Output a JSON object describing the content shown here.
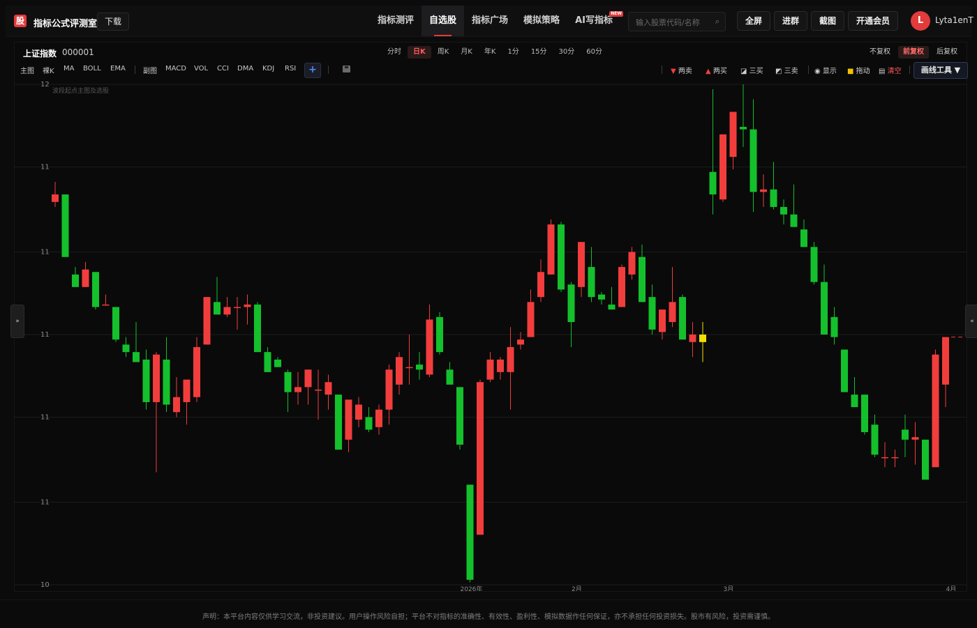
{
  "header": {
    "logo_char": "股",
    "brand": "指标公式评测室",
    "download_label": "下载",
    "nav": [
      {
        "label": "指标测评"
      },
      {
        "label": "自选股"
      },
      {
        "label": "指标广场"
      },
      {
        "label": "模拟策略"
      },
      {
        "label": "AI写指标"
      }
    ],
    "nav_active": "自选股",
    "new_tag": "NEW",
    "search_placeholder": "输入股票代码/名称",
    "buttons": {
      "fullscreen": "全屏",
      "join_group": "进群",
      "screenshot": "截图",
      "vip": "开通会员"
    },
    "avatar_letter": "L",
    "username": "Lyta1enT"
  },
  "symbol": {
    "name": "上证指数",
    "code": "000001"
  },
  "periods": [
    "分时",
    "日K",
    "周K",
    "月K",
    "年K",
    "1分",
    "15分",
    "30分",
    "60分"
  ],
  "period_active": "日K",
  "adjust": [
    "不复权",
    "前复权",
    "后复权"
  ],
  "adjust_active": "前复权",
  "indicators_main": [
    "主图",
    "裸K",
    "MA",
    "BOLL",
    "EMA"
  ],
  "indicators_sub": [
    "副图",
    "MACD",
    "VOL",
    "CCI",
    "DMA",
    "KDJ",
    "RSI"
  ],
  "plus_label": "+",
  "right_tools": {
    "sell2": "两卖",
    "buy2": "两买",
    "buy3": "三买",
    "sell3": "三卖",
    "show": "显示",
    "drag": "拖动",
    "clear": "清空",
    "draw": "画线工具 ▼"
  },
  "chart_note": "波段起点主图及选股",
  "side_left": "»",
  "side_right": "«",
  "footer": {
    "disclaimer": "声明：本平台内容仅供学习交流，非投资建议。用户操作风险自担；平台不对指标的准确性、有效性、盈利性、模拟数据作任何保证，亦不承担任何投资损失。股市有风险，投资需谨慎。"
  },
  "colors": {
    "up": "#f23d3d",
    "down": "#14c02c",
    "highlight": "#f5e000",
    "accent": "#e23b3b",
    "grid": "#1c1c1c"
  },
  "chart_data": {
    "type": "candlestick",
    "ylim": [
      10,
      12
    ],
    "y_ticks": [
      12,
      11.67,
      11.33,
      11,
      10.67,
      10.33,
      10
    ],
    "y_tick_labels": [
      "12",
      "11",
      "11",
      "11",
      "11",
      "11",
      "10"
    ],
    "x_labels": [
      {
        "index": 41,
        "label": "2026年"
      },
      {
        "index": 52,
        "label": "2月"
      },
      {
        "index": 67,
        "label": "3月"
      },
      {
        "index": 89,
        "label": "4月"
      }
    ],
    "candles": [
      {
        "o": 11.53,
        "h": 11.61,
        "l": 11.51,
        "c": 11.56
      },
      {
        "o": 11.56,
        "h": 11.56,
        "l": 11.31,
        "c": 11.31
      },
      {
        "o": 11.24,
        "h": 11.27,
        "l": 11.19,
        "c": 11.19
      },
      {
        "o": 11.19,
        "h": 11.29,
        "l": 11.19,
        "c": 11.26
      },
      {
        "o": 11.25,
        "h": 11.25,
        "l": 11.1,
        "c": 11.11
      },
      {
        "o": 11.12,
        "h": 11.16,
        "l": 11.12,
        "c": 11.12
      },
      {
        "o": 11.11,
        "h": 11.11,
        "l": 10.97,
        "c": 10.98
      },
      {
        "o": 10.96,
        "h": 10.99,
        "l": 10.91,
        "c": 10.93
      },
      {
        "o": 10.93,
        "h": 11.05,
        "l": 10.89,
        "c": 10.89
      },
      {
        "o": 10.9,
        "h": 10.94,
        "l": 10.7,
        "c": 10.73
      },
      {
        "o": 10.73,
        "h": 10.93,
        "l": 10.45,
        "c": 10.92
      },
      {
        "o": 10.9,
        "h": 10.99,
        "l": 10.69,
        "c": 10.72
      },
      {
        "o": 10.69,
        "h": 10.83,
        "l": 10.67,
        "c": 10.75
      },
      {
        "o": 10.73,
        "h": 10.82,
        "l": 10.64,
        "c": 10.82
      },
      {
        "o": 10.75,
        "h": 10.99,
        "l": 10.73,
        "c": 10.95
      },
      {
        "o": 10.96,
        "h": 11.15,
        "l": 10.96,
        "c": 11.15
      },
      {
        "o": 11.13,
        "h": 11.23,
        "l": 11.08,
        "c": 11.08
      },
      {
        "o": 11.08,
        "h": 11.15,
        "l": 11.07,
        "c": 11.11
      },
      {
        "o": 11.11,
        "h": 11.15,
        "l": 11.02,
        "c": 11.11
      },
      {
        "o": 11.11,
        "h": 11.16,
        "l": 11.04,
        "c": 11.12
      },
      {
        "o": 11.12,
        "h": 11.13,
        "l": 10.93,
        "c": 10.93
      },
      {
        "o": 10.93,
        "h": 10.95,
        "l": 10.85,
        "c": 10.85
      },
      {
        "o": 10.9,
        "h": 10.91,
        "l": 10.87,
        "c": 10.87
      },
      {
        "o": 10.85,
        "h": 10.86,
        "l": 10.69,
        "c": 10.77
      },
      {
        "o": 10.77,
        "h": 10.85,
        "l": 10.72,
        "c": 10.79
      },
      {
        "o": 10.79,
        "h": 10.86,
        "l": 10.72,
        "c": 10.86
      },
      {
        "o": 10.78,
        "h": 10.86,
        "l": 10.66,
        "c": 10.78
      },
      {
        "o": 10.76,
        "h": 10.84,
        "l": 10.7,
        "c": 10.81
      },
      {
        "o": 10.76,
        "h": 10.76,
        "l": 10.54,
        "c": 10.54
      },
      {
        "o": 10.58,
        "h": 10.74,
        "l": 10.53,
        "c": 10.74
      },
      {
        "o": 10.66,
        "h": 10.75,
        "l": 10.63,
        "c": 10.72
      },
      {
        "o": 10.67,
        "h": 10.71,
        "l": 10.61,
        "c": 10.62
      },
      {
        "o": 10.63,
        "h": 10.72,
        "l": 10.6,
        "c": 10.7
      },
      {
        "o": 10.7,
        "h": 10.88,
        "l": 10.64,
        "c": 10.86
      },
      {
        "o": 10.8,
        "h": 10.93,
        "l": 10.76,
        "c": 10.91
      },
      {
        "o": 10.87,
        "h": 11.0,
        "l": 10.8,
        "c": 10.87
      },
      {
        "o": 10.88,
        "h": 10.93,
        "l": 10.82,
        "c": 10.86
      },
      {
        "o": 10.84,
        "h": 11.12,
        "l": 10.83,
        "c": 11.06
      },
      {
        "o": 11.07,
        "h": 11.09,
        "l": 10.92,
        "c": 10.93
      },
      {
        "o": 10.86,
        "h": 10.89,
        "l": 10.8,
        "c": 10.8
      },
      {
        "o": 10.79,
        "h": 10.79,
        "l": 10.54,
        "c": 10.56
      },
      {
        "o": 10.4,
        "h": 10.4,
        "l": 10.01,
        "c": 10.02
      },
      {
        "o": 10.2,
        "h": 10.82,
        "l": 10.2,
        "c": 10.81
      },
      {
        "o": 10.82,
        "h": 10.93,
        "l": 10.81,
        "c": 10.9
      },
      {
        "o": 10.85,
        "h": 10.91,
        "l": 10.82,
        "c": 10.9
      },
      {
        "o": 10.85,
        "h": 11.03,
        "l": 10.7,
        "c": 10.95
      },
      {
        "o": 10.96,
        "h": 11.01,
        "l": 10.94,
        "c": 10.98
      },
      {
        "o": 10.99,
        "h": 11.18,
        "l": 10.99,
        "c": 11.13
      },
      {
        "o": 11.15,
        "h": 11.3,
        "l": 11.13,
        "c": 11.25
      },
      {
        "o": 11.24,
        "h": 11.46,
        "l": 11.24,
        "c": 11.44
      },
      {
        "o": 11.44,
        "h": 11.45,
        "l": 11.17,
        "c": 11.18
      },
      {
        "o": 11.2,
        "h": 11.21,
        "l": 10.95,
        "c": 11.05
      },
      {
        "o": 11.19,
        "h": 11.36,
        "l": 11.15,
        "c": 11.37
      },
      {
        "o": 11.27,
        "h": 11.35,
        "l": 11.13,
        "c": 11.15
      },
      {
        "o": 11.16,
        "h": 11.17,
        "l": 11.12,
        "c": 11.14
      },
      {
        "o": 11.12,
        "h": 11.19,
        "l": 11.1,
        "c": 11.1
      },
      {
        "o": 11.11,
        "h": 11.28,
        "l": 11.11,
        "c": 11.27
      },
      {
        "o": 11.24,
        "h": 11.35,
        "l": 11.22,
        "c": 11.33
      },
      {
        "o": 11.31,
        "h": 11.36,
        "l": 11.13,
        "c": 11.13
      },
      {
        "o": 11.15,
        "h": 11.2,
        "l": 11.0,
        "c": 11.02
      },
      {
        "o": 11.01,
        "h": 11.08,
        "l": 10.98,
        "c": 11.1
      },
      {
        "o": 11.05,
        "h": 11.27,
        "l": 11.03,
        "c": 11.13
      },
      {
        "o": 11.15,
        "h": 11.16,
        "l": 10.98,
        "c": 10.98
      },
      {
        "o": 10.97,
        "h": 11.05,
        "l": 10.91,
        "c": 11.0
      },
      {
        "o": 10.97,
        "h": 11.05,
        "l": 10.89,
        "c": 11.0
      },
      {
        "o": 11.65,
        "h": 11.98,
        "l": 11.48,
        "c": 11.56
      },
      {
        "o": 11.54,
        "h": 11.8,
        "l": 11.53,
        "c": 11.8
      },
      {
        "o": 11.71,
        "h": 11.87,
        "l": 11.66,
        "c": 11.89
      },
      {
        "o": 11.83,
        "h": 12.0,
        "l": 11.75,
        "c": 11.82
      },
      {
        "o": 11.82,
        "h": 11.94,
        "l": 11.49,
        "c": 11.57
      },
      {
        "o": 11.57,
        "h": 11.64,
        "l": 11.51,
        "c": 11.58
      },
      {
        "o": 11.58,
        "h": 11.69,
        "l": 11.5,
        "c": 11.51
      },
      {
        "o": 11.51,
        "h": 11.54,
        "l": 11.44,
        "c": 11.48
      },
      {
        "o": 11.48,
        "h": 11.6,
        "l": 11.43,
        "c": 11.43
      },
      {
        "o": 11.42,
        "h": 11.46,
        "l": 11.35,
        "c": 11.35
      },
      {
        "o": 11.35,
        "h": 11.37,
        "l": 11.2,
        "c": 11.21
      },
      {
        "o": 11.21,
        "h": 11.28,
        "l": 11.0,
        "c": 11.0
      },
      {
        "o": 11.07,
        "h": 11.11,
        "l": 10.96,
        "c": 10.99
      },
      {
        "o": 10.94,
        "h": 10.94,
        "l": 10.77,
        "c": 10.77
      },
      {
        "o": 10.76,
        "h": 10.83,
        "l": 10.71,
        "c": 10.71
      },
      {
        "o": 10.76,
        "h": 10.76,
        "l": 10.6,
        "c": 10.61
      },
      {
        "o": 10.64,
        "h": 10.68,
        "l": 10.51,
        "c": 10.52
      },
      {
        "o": 10.51,
        "h": 10.57,
        "l": 10.47,
        "c": 10.51
      },
      {
        "o": 10.51,
        "h": 10.54,
        "l": 10.47,
        "c": 10.51
      },
      {
        "o": 10.62,
        "h": 10.68,
        "l": 10.51,
        "c": 10.58
      },
      {
        "o": 10.58,
        "h": 10.65,
        "l": 10.48,
        "c": 10.59
      },
      {
        "o": 10.58,
        "h": 10.58,
        "l": 10.43,
        "c": 10.42
      },
      {
        "o": 10.47,
        "h": 10.94,
        "l": 10.47,
        "c": 10.92
      },
      {
        "o": 10.8,
        "h": 10.99,
        "l": 10.71,
        "c": 10.99
      }
    ]
  }
}
